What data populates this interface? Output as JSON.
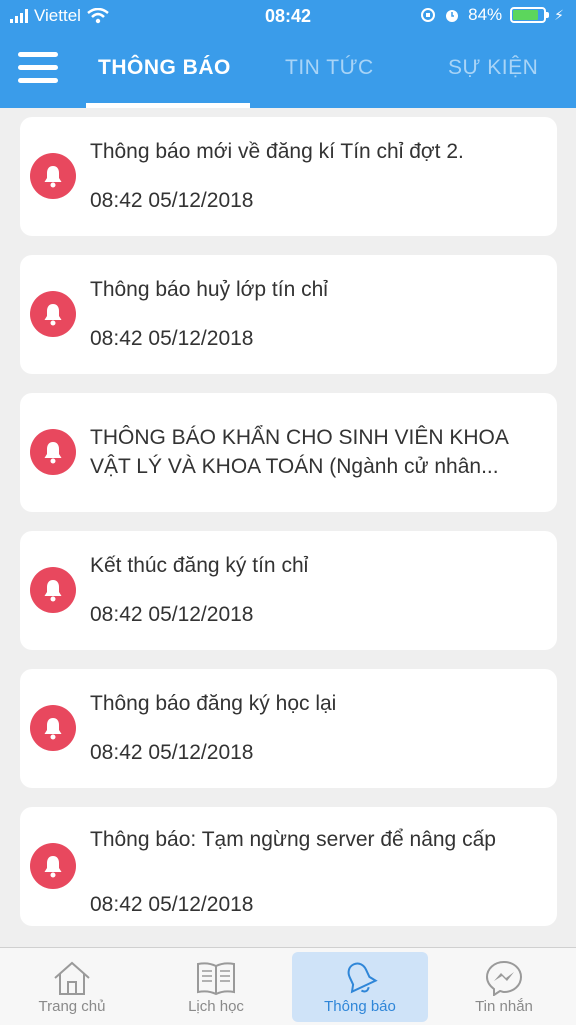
{
  "status_bar": {
    "carrier": "Viettel",
    "time": "08:42",
    "battery": "84%",
    "battery_level": 0.84
  },
  "tabs": [
    {
      "label": "THÔNG BÁO",
      "active": true
    },
    {
      "label": "TIN TỨC",
      "active": false
    },
    {
      "label": "SỰ KIỆN",
      "active": false
    }
  ],
  "notifications": [
    {
      "title": "Thông báo mới về đăng kí Tín chỉ đợt 2.",
      "time": "08:42 05/12/2018"
    },
    {
      "title": "Thông báo huỷ lớp tín chỉ",
      "time": "08:42 05/12/2018"
    },
    {
      "title": "THÔNG BÁO KHẨN CHO SINH VIÊN KHOA VẬT LÝ VÀ KHOA TOÁN (Ngành cử nhân...",
      "time": ""
    },
    {
      "title": "Kết thúc đăng ký tín chỉ",
      "time": "08:42 05/12/2018"
    },
    {
      "title": "Thông báo đăng ký học lại",
      "time": "08:42 05/12/2018"
    },
    {
      "title": "Thông báo: Tạm ngừng server để nâng cấp",
      "time": "08:42 05/12/2018"
    }
  ],
  "bottom_nav": [
    {
      "label": "Trang chủ",
      "icon": "home-icon",
      "active": false
    },
    {
      "label": "Lịch học",
      "icon": "book-icon",
      "active": false
    },
    {
      "label": "Thông báo",
      "icon": "bell-icon",
      "active": true
    },
    {
      "label": "Tin nhắn",
      "icon": "messenger-icon",
      "active": false
    }
  ],
  "colors": {
    "header": "#3a9cea",
    "bell": "#e8485e",
    "nav_active_bg": "#cfe3f8",
    "nav_active_text": "#2f86d8"
  }
}
